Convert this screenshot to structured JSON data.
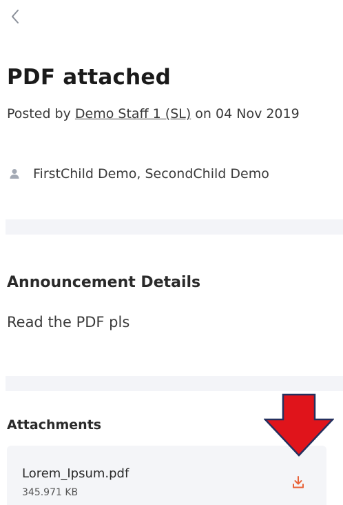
{
  "announcement": {
    "title": "PDF attached",
    "posted_prefix": "Posted by ",
    "author": "Demo Staff 1 (SL)",
    "posted_suffix": " on 04 Nov 2019",
    "recipients": "FirstChild Demo, SecondChild Demo",
    "recipients_icon": "person-icon"
  },
  "details": {
    "heading": "Announcement Details",
    "body": "Read the PDF pls"
  },
  "attachments": {
    "heading": "Attachments",
    "items": [
      {
        "file_name": "Lorem_Ipsum.pdf",
        "file_size": "345.971 KB",
        "action_icon": "download-icon"
      }
    ]
  },
  "colors": {
    "accent_download": "#e8643a",
    "annotation_arrow": "#e0141b",
    "band": "#f3f4f8"
  }
}
